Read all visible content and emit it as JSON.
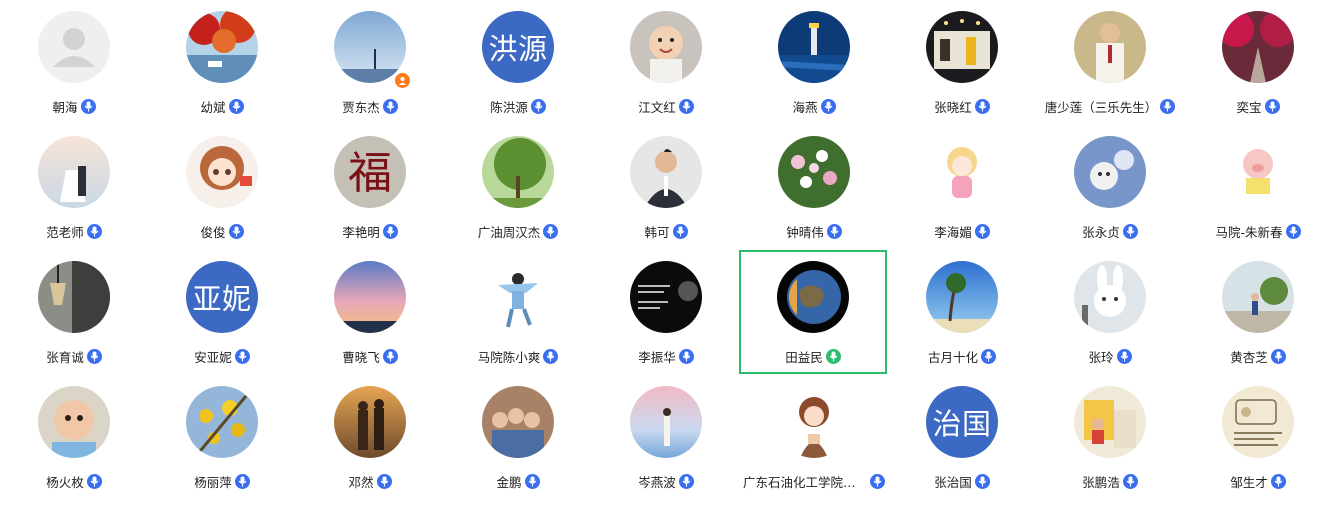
{
  "contacts": [
    {
      "name": "朝海",
      "avatar": "placeholder"
    },
    {
      "name": "幼斌",
      "avatar": "red-maple-lake-photo"
    },
    {
      "name": "贾东杰",
      "avatar": "blue-sky-photo",
      "badge": "person-icon"
    },
    {
      "name": "陈洪源",
      "avatar_text": "洪源"
    },
    {
      "name": "江文红",
      "avatar": "baby-photo"
    },
    {
      "name": "海燕",
      "avatar": "lighthouse-photo"
    },
    {
      "name": "张晓红",
      "avatar": "night-cafe-photo"
    },
    {
      "name": "唐少莲（三乐先生）",
      "avatar": "man-portrait-photo"
    },
    {
      "name": "奕宝",
      "avatar": "red-trees-path-photo"
    },
    {
      "name": "范老师",
      "avatar": "wedding-beach-photo"
    },
    {
      "name": "俊俊",
      "avatar": "anime-girl-drawing"
    },
    {
      "name": "李艳明",
      "avatar": "fu-calligraphy"
    },
    {
      "name": "广油周汉杰",
      "avatar": "tree-photo"
    },
    {
      "name": "韩可",
      "avatar": "man-suit-photo"
    },
    {
      "name": "钟晴伟",
      "avatar": "flowers-photo"
    },
    {
      "name": "李海媚",
      "avatar": "cartoon-girl-drawing"
    },
    {
      "name": "张永贞",
      "avatar": "cat-sky-drawing"
    },
    {
      "name": "马院-朱新春",
      "avatar": "pig-book-cartoon"
    },
    {
      "name": "张育诚",
      "avatar": "lamp-window-photo"
    },
    {
      "name": "安亚妮",
      "avatar_text": "亚妮"
    },
    {
      "name": "曹晓飞",
      "avatar": "sunset-sky-photo"
    },
    {
      "name": "马院陈小爽",
      "avatar": "girl-jumping-photo"
    },
    {
      "name": "李振华",
      "avatar": "black-quote-image"
    },
    {
      "name": "田益民",
      "avatar": "earth-planet-image",
      "selected": true,
      "speaking": true
    },
    {
      "name": "古月十化",
      "avatar": "palm-beach-photo"
    },
    {
      "name": "张玲",
      "avatar": "white-rabbit-image"
    },
    {
      "name": "黄杏芝",
      "avatar": "child-park-photo"
    },
    {
      "name": "杨火枚",
      "avatar": "baby-face-photo"
    },
    {
      "name": "杨丽萍",
      "avatar": "yellow-flowers-photo"
    },
    {
      "name": "邓然",
      "avatar": "couple-sunset-photo"
    },
    {
      "name": "金鹏",
      "avatar": "four-kids-photo"
    },
    {
      "name": "岑燕波",
      "avatar": "girl-pastel-sky-photo"
    },
    {
      "name": "广东石油化工学院谭...",
      "avatar": "cartoon-woman-drawing"
    },
    {
      "name": "张治国",
      "avatar_text": "治国"
    },
    {
      "name": "张鹏浩",
      "avatar": "kids-house-photo"
    },
    {
      "name": "邹生才",
      "avatar": "sketch-text-image"
    }
  ],
  "colors": {
    "mic_badge": "#3a6df0",
    "speaking_mic": "#2bbd6c",
    "selected_border": "#2bbd6c",
    "text_avatar_bg": "#3c69c4"
  },
  "icons": {
    "mic": "microphone-icon",
    "badge": "person-icon"
  }
}
